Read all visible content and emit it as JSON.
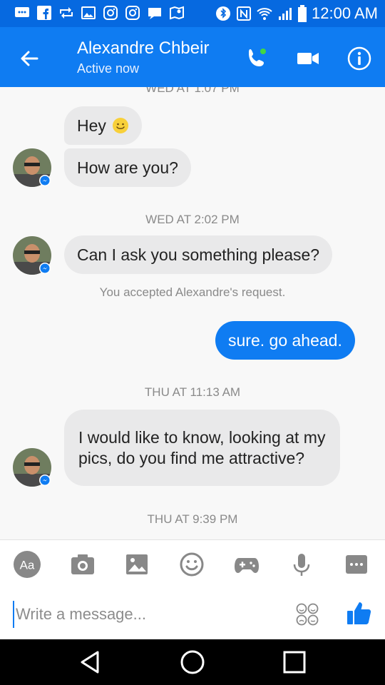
{
  "status_bar": {
    "time": "12:00 AM",
    "notification_icons": [
      "message-icon",
      "facebook-icon",
      "retweet-icon",
      "gallery-icon",
      "instagram-icon",
      "instagram-icon",
      "chat-icon",
      "maps-icon"
    ],
    "system_icons": [
      "bluetooth-icon",
      "nfc-icon",
      "wifi-icon",
      "signal-icon",
      "battery-icon"
    ]
  },
  "header": {
    "contact_name": "Alexandre Chbeir",
    "presence": "Active now",
    "accent_color": "#0f7cf2"
  },
  "conversation": {
    "partial_timestamp": "WED AT 1:07 PM",
    "messages": [
      {
        "from": "them",
        "text": "Hey"
      },
      {
        "from": "them",
        "text": "How are you?"
      },
      {
        "timestamp": "WED AT 2:02 PM"
      },
      {
        "from": "them",
        "text": "Can I ask you something please?"
      },
      {
        "notice": "You accepted Alexandre's request."
      },
      {
        "from": "me",
        "text": "sure. go ahead."
      },
      {
        "timestamp": "THU AT 11:13 AM"
      },
      {
        "from": "them",
        "text": "I would like to know, looking at my pics, do you find me attractive?"
      },
      {
        "timestamp": "THU AT 9:39 PM"
      }
    ]
  },
  "composer": {
    "placeholder": "Write a message...",
    "toolbar_labels": {
      "text_style": "Aa"
    }
  }
}
